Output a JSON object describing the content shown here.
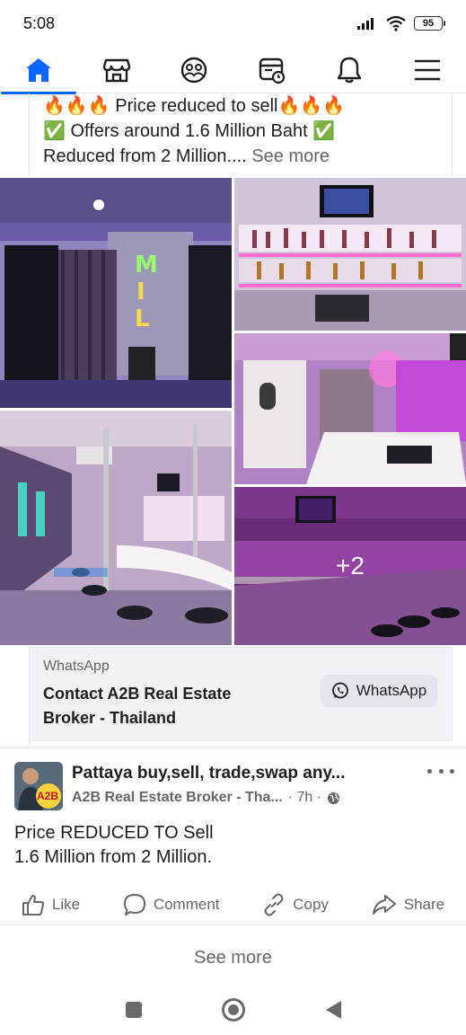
{
  "status_bar": {
    "time": "5:08",
    "battery": "95"
  },
  "nav": {
    "items": [
      {
        "name": "home-icon",
        "active": true
      },
      {
        "name": "marketplace-icon",
        "active": false
      },
      {
        "name": "groups-icon",
        "active": false
      },
      {
        "name": "feeds-icon",
        "active": false
      },
      {
        "name": "notifications-icon",
        "active": false
      },
      {
        "name": "menu-icon",
        "active": false
      }
    ],
    "accent": "#0866ff"
  },
  "post1": {
    "line1": "🔥🔥🔥 Price reduced to sell🔥🔥🔥",
    "line2": "✅ Offers around 1.6 Million Baht ✅",
    "line3": "Reduced from 2 Million.... ",
    "see_more": "See more",
    "gallery": {
      "more_count": "+2"
    },
    "whatsapp_card": {
      "source": "WhatsApp",
      "title": "Contact A2B Real Estate Broker - Thailand",
      "button_label": "WhatsApp"
    }
  },
  "post2": {
    "group": "Pattaya buy,sell, trade,swap any...",
    "page": "A2B Real Estate Broker - Tha...",
    "time": "· 7h ·",
    "avatar_badge": "A2B",
    "text_line1": "Price REDUCED TO Sell",
    "text_line2": "1.6 Million from 2 Million.",
    "actions": {
      "like": "Like",
      "comment": "Comment",
      "copy": "Copy",
      "share": "Share"
    }
  },
  "see_more_posts": "See more"
}
